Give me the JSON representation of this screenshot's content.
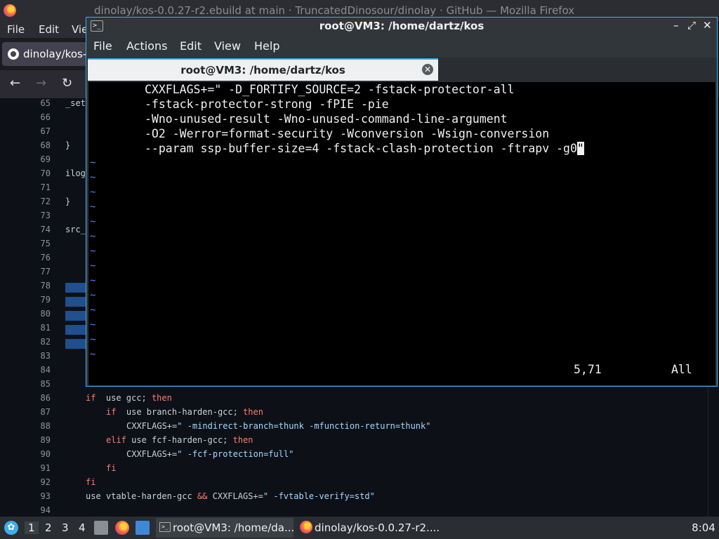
{
  "firefox": {
    "window_title": "dinolay/kos-0.0.27-r2.ebuild at main · TruncatedDinosour/dinolay · GitHub — Mozilla Firefox",
    "menu": [
      "File",
      "Edit",
      "Vie"
    ],
    "tab_title": "dinolay/kos-0",
    "nav": {
      "back": "←",
      "forward": "→",
      "reload": "↻"
    }
  },
  "code_view": {
    "lines": [
      {
        "n": "65",
        "text": "_set",
        "indent": 0
      },
      {
        "n": "66",
        "text": "",
        "indent": 0
      },
      {
        "n": "67",
        "text": "",
        "indent": 0
      },
      {
        "n": "68",
        "text": "}",
        "indent": 0
      },
      {
        "n": "69",
        "text": "",
        "indent": 0
      },
      {
        "n": "70",
        "text": "ilog",
        "indent": 0
      },
      {
        "n": "71",
        "text": "",
        "indent": 0
      },
      {
        "n": "72",
        "text": "}",
        "indent": 0
      },
      {
        "n": "73",
        "text": "",
        "indent": 0
      },
      {
        "n": "74",
        "text": "src_",
        "indent": 0
      },
      {
        "n": "75",
        "text": "",
        "indent": 0
      },
      {
        "n": "76",
        "text": "",
        "indent": 0
      },
      {
        "n": "77",
        "text": "",
        "indent": 0
      },
      {
        "n": "78",
        "text": "",
        "indent": 0
      },
      {
        "n": "79",
        "text": "",
        "indent": 0
      },
      {
        "n": "80",
        "text": "",
        "indent": 0
      },
      {
        "n": "81",
        "text": "",
        "indent": 0
      },
      {
        "n": "82",
        "text": "",
        "indent": 0
      },
      {
        "n": "83",
        "text": "",
        "indent": 0
      },
      {
        "n": "84",
        "text": "",
        "indent": 0
      },
      {
        "n": "85",
        "text": "",
        "indent": 0
      },
      {
        "n": "86",
        "parts": [
          [
            "kw",
            "if"
          ],
          [
            "",
            "  use gcc; "
          ],
          [
            "kw",
            "then"
          ]
        ],
        "indent": 1
      },
      {
        "n": "87",
        "parts": [
          [
            "kw",
            "if"
          ],
          [
            "",
            "  use branch-harden-gcc; "
          ],
          [
            "kw",
            "then"
          ]
        ],
        "indent": 2
      },
      {
        "n": "88",
        "parts": [
          [
            "",
            "CXXFLAGS+="
          ],
          [
            "str",
            "\" -mindirect-branch=thunk -mfunction-return=thunk\""
          ]
        ],
        "indent": 3
      },
      {
        "n": "89",
        "parts": [
          [
            "kw",
            "elif"
          ],
          [
            "",
            " use fcf-harden-gcc; "
          ],
          [
            "kw",
            "then"
          ]
        ],
        "indent": 2
      },
      {
        "n": "90",
        "parts": [
          [
            "",
            "CXXFLAGS+="
          ],
          [
            "str",
            "\" -fcf-protection=full\""
          ]
        ],
        "indent": 3
      },
      {
        "n": "91",
        "parts": [
          [
            "kw",
            "fi"
          ]
        ],
        "indent": 2
      },
      {
        "n": "92",
        "parts": [
          [
            "kw",
            "fi"
          ]
        ],
        "indent": 1
      },
      {
        "n": "93",
        "parts": [
          [
            "",
            "use vtable-harden-gcc "
          ],
          [
            "kw",
            "&&"
          ],
          [
            "",
            " CXXFLAGS+="
          ],
          [
            "str",
            "\" -fvtable-verify=std\""
          ]
        ],
        "indent": 1
      },
      {
        "n": "94",
        "text": "",
        "indent": 0
      }
    ]
  },
  "terminal": {
    "window_title": "root@VM3: /home/dartz/kos",
    "window_buttons": [
      "–",
      "⤢",
      "✕"
    ],
    "menu": [
      "File",
      "Actions",
      "Edit",
      "View",
      "Help"
    ],
    "tab_label": "root@VM3: /home/dartz/kos",
    "lines": [
      "CXXFLAGS+=\" -D_FORTIFY_SOURCE=2 -fstack-protector-all",
      "-fstack-protector-strong -fPIE -pie",
      "-Wno-unused-result -Wno-unused-command-line-argument",
      "-O2 -Werror=format-security -Wconversion -Wsign-conversion",
      "--param ssp-buffer-size=4 -fstack-clash-protection -ftrapv -g0"
    ],
    "cursor_char": "\"",
    "tilde": "~",
    "tilde_count": 14,
    "status_position": "5,71",
    "status_scroll": "All"
  },
  "taskbar": {
    "workspaces": [
      "1",
      "2",
      "3",
      "4"
    ],
    "tasks": [
      {
        "label": "root@VM3: /home/da...",
        "active": true
      },
      {
        "label": "dinolay/kos-0.0.27-r2....",
        "active": false
      }
    ],
    "clock": "8:04"
  },
  "colors": {
    "accent": "#3daee9",
    "keyword": "#ff7b72",
    "string": "#a5d6ff",
    "tilde": "#5c7cfa"
  }
}
